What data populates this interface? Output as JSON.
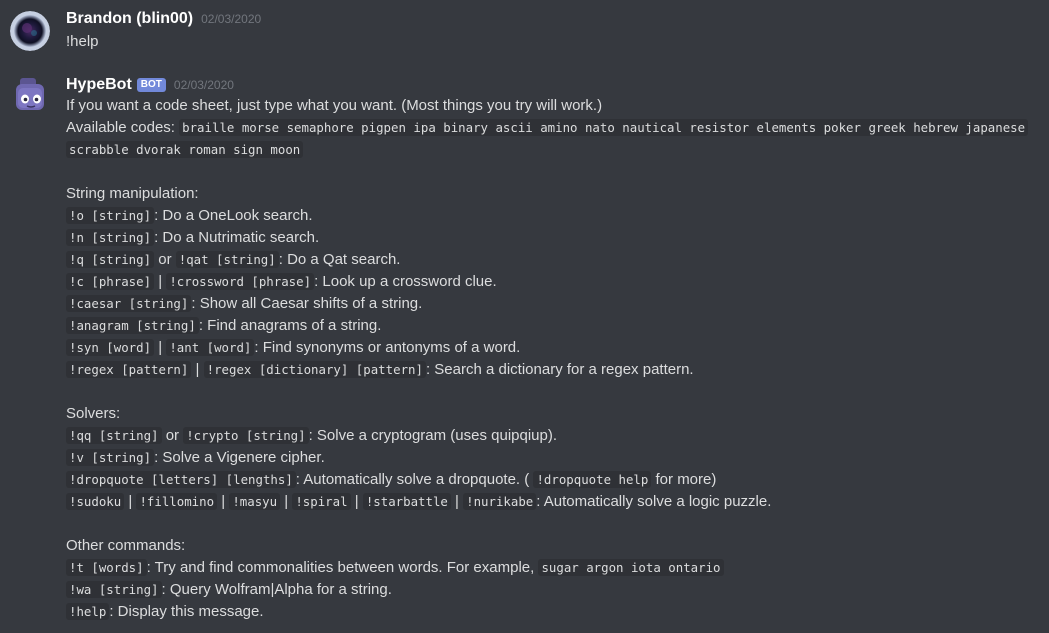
{
  "messages": {
    "user": {
      "name": "Brandon (blin00)",
      "timestamp": "02/03/2020",
      "text": "!help"
    },
    "bot": {
      "name": "HypeBot",
      "tag": "BOT",
      "timestamp": "02/03/2020",
      "intro": "If you want a code sheet, just type what you want. (Most things you try will work.)",
      "codes_label": "Available codes:",
      "codes_line1": "braille morse semaphore pigpen ipa binary ascii amino nato nautical resistor elements poker greek hebrew japanese",
      "codes_line2": "scrabble dvorak roman sign moon",
      "sections": {
        "string": {
          "title": "String manipulation:",
          "onelook_cmd": "!o [string]",
          "onelook_desc": ": Do a OneLook search.",
          "nutri_cmd": "!n [string]",
          "nutri_desc": ": Do a Nutrimatic search.",
          "qat_cmd1": "!q [string]",
          "qat_or": "or",
          "qat_cmd2": "!qat [string]",
          "qat_desc": ": Do a Qat search.",
          "cross_cmd1": "!c [phrase]",
          "cross_sep": "|",
          "cross_cmd2": "!crossword [phrase]",
          "cross_desc": ": Look up a crossword clue.",
          "caesar_cmd": "!caesar [string]",
          "caesar_desc": ": Show all Caesar shifts of a string.",
          "anagram_cmd": "!anagram [string]",
          "anagram_desc": ": Find anagrams of a string.",
          "syn_cmd1": "!syn [word]",
          "syn_sep": "|",
          "syn_cmd2": "!ant [word]",
          "syn_desc": ": Find synonyms or antonyms of a word.",
          "regex_cmd1": "!regex [pattern]",
          "regex_sep": "|",
          "regex_cmd2": "!regex [dictionary] [pattern]",
          "regex_desc": ": Search a dictionary for a regex pattern."
        },
        "solvers": {
          "title": "Solvers:",
          "qq_cmd1": "!qq [string]",
          "qq_or": "or",
          "qq_cmd2": "!crypto [string]",
          "qq_desc": ": Solve a cryptogram (uses quipqiup).",
          "v_cmd": "!v [string]",
          "v_desc": ": Solve a Vigenere cipher.",
          "drop_cmd": "!dropquote [letters] [lengths]",
          "drop_desc": ": Automatically solve a dropquote. (",
          "drop_help_cmd": "!dropquote help",
          "drop_tail": "for more)",
          "logic_cmds": [
            "!sudoku",
            "!fillomino",
            "!masyu",
            "!spiral",
            "!starbattle",
            "!nurikabe"
          ],
          "logic_sep": "|",
          "logic_desc": ": Automatically solve a logic puzzle."
        },
        "other": {
          "title": "Other commands:",
          "t_cmd": "!t [words]",
          "t_desc": ": Try and find commonalities between words. For example,",
          "t_example": "sugar argon iota ontario",
          "wa_cmd": "!wa [string]",
          "wa_desc": ": Query Wolfram|Alpha for a string.",
          "help_cmd": "!help",
          "help_desc": ": Display this message."
        }
      }
    }
  },
  "colors": {
    "background": "#36393f",
    "text": "#dcddde",
    "username": "#ffffff",
    "timestamp": "#72767d",
    "bot_tag": "#7289da",
    "code_bg": "#2f3136"
  },
  "icons": {
    "user_avatar": "user-avatar",
    "bot_avatar": "bot-avatar"
  }
}
